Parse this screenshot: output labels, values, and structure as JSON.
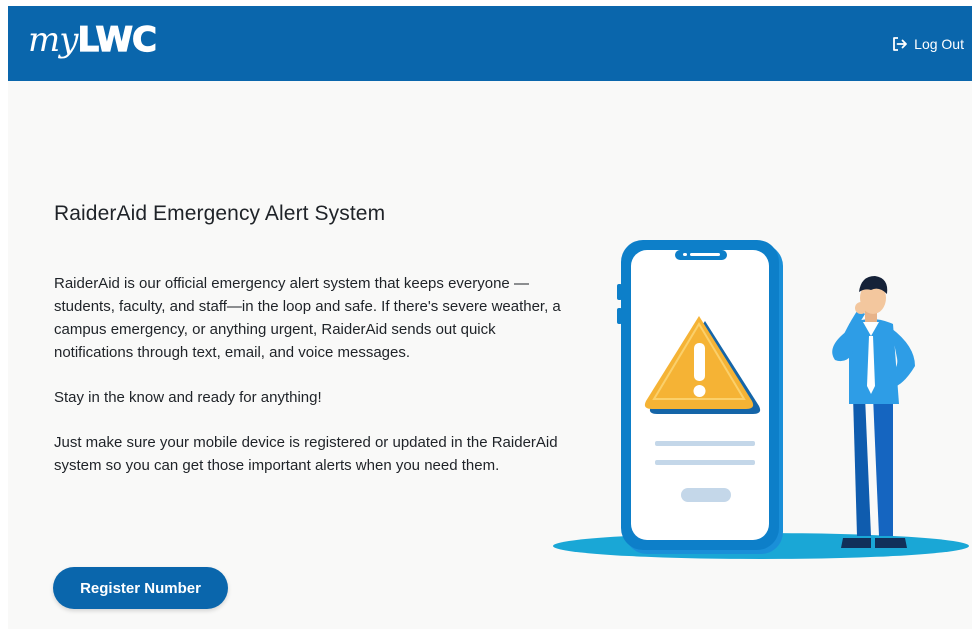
{
  "header": {
    "logo_my": "my",
    "logo_lwc": "LWC",
    "logout_label": "Log Out",
    "logout_icon": "logout-icon"
  },
  "main": {
    "title": "RaiderAid Emergency Alert System",
    "paragraphs": [
      "RaiderAid is our official emergency alert system that keeps everyone —students, faculty, and staff—in the loop and safe. If there's severe weather, a campus emergency, or anything urgent, RaiderAid sends out quick notifications through text, email, and voice messages.",
      "Stay in the know and ready for anything!",
      "Just make sure your mobile device is registered or updated in the RaiderAid system so you can get those important alerts when you need them."
    ],
    "register_button": "Register Number"
  },
  "colors": {
    "brand": "#0a66ac",
    "background": "#f9f9f8",
    "warning": "#f5b335",
    "accent_teal": "#1aa7d6"
  }
}
